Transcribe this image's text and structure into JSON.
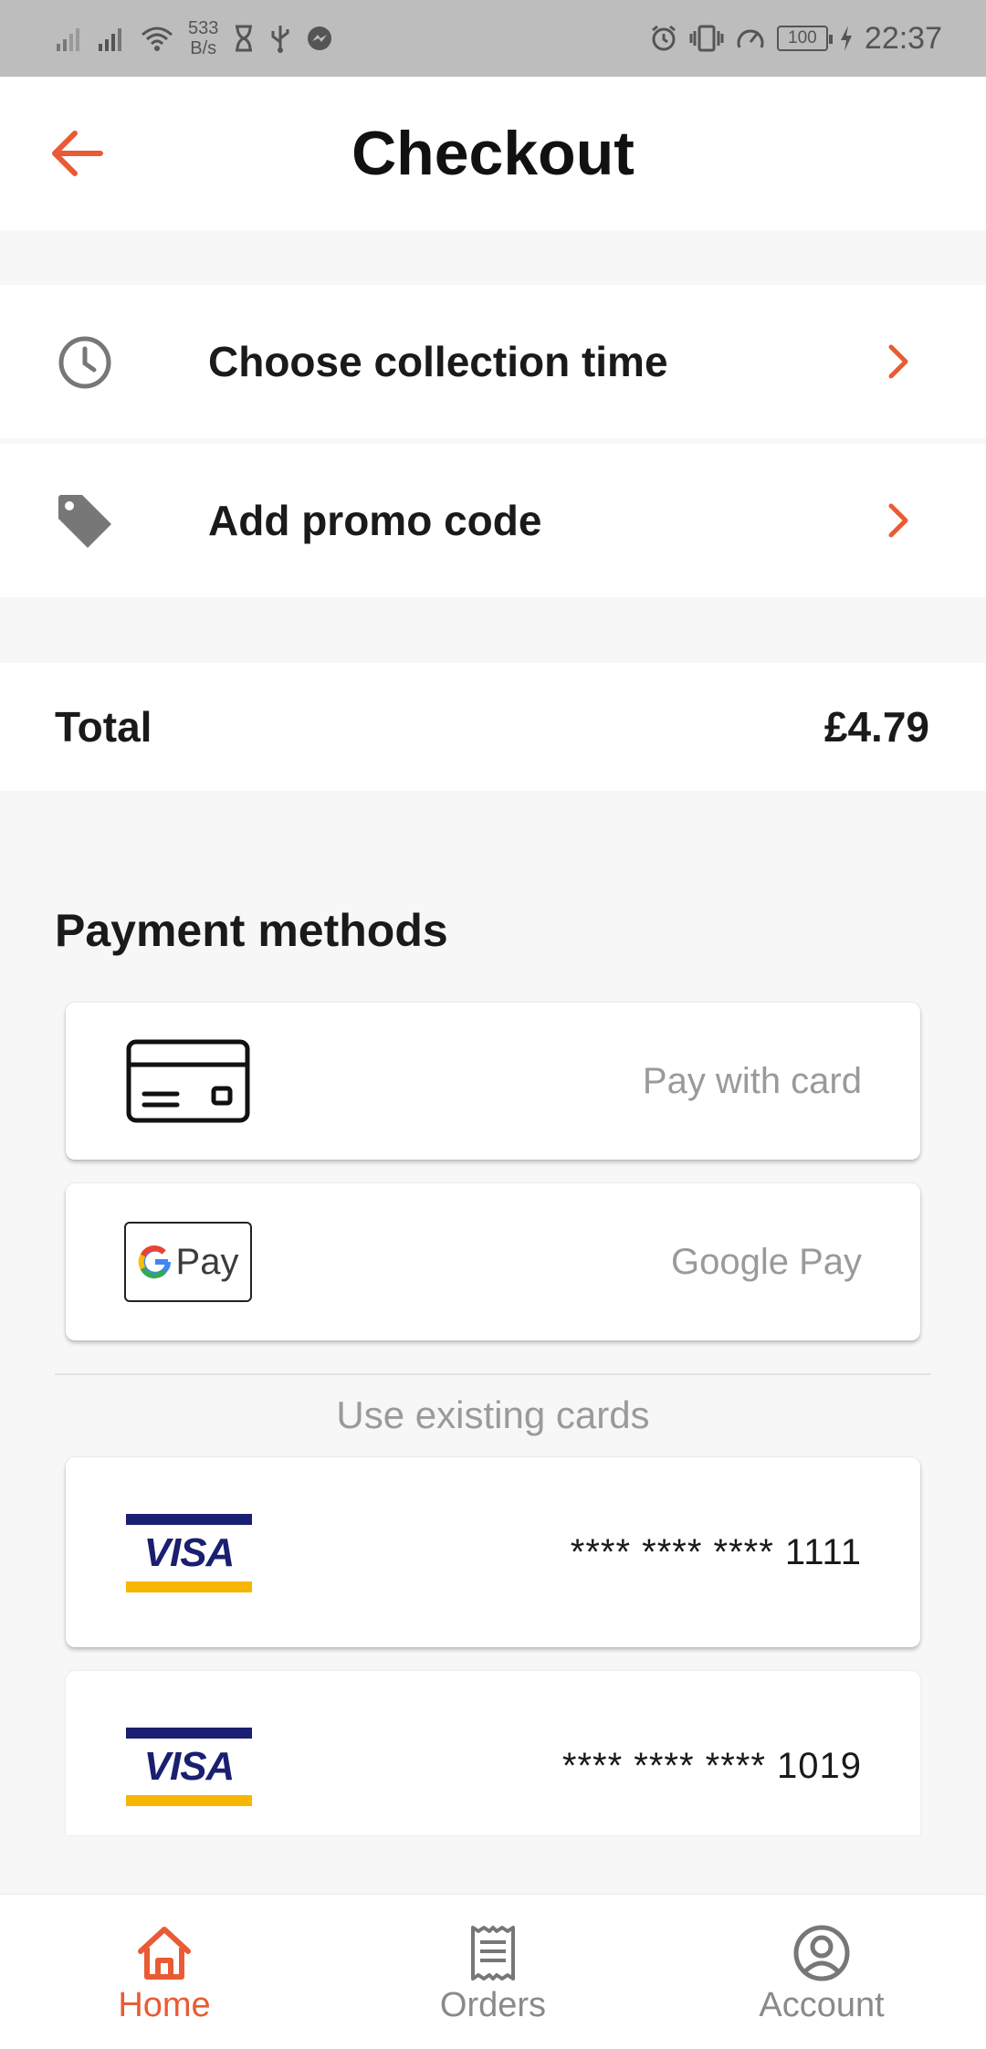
{
  "status_bar": {
    "net_speed_value": "533",
    "net_speed_unit": "B/s",
    "battery": "100",
    "time": "22:37"
  },
  "header": {
    "title": "Checkout",
    "back_icon": "arrow-left-icon"
  },
  "options": [
    {
      "label": "Choose collection time",
      "icon": "clock-icon"
    },
    {
      "label": "Add promo code",
      "icon": "tag-icon"
    }
  ],
  "total": {
    "label": "Total",
    "value": "£4.79"
  },
  "payment": {
    "title": "Payment methods",
    "methods": [
      {
        "label": "Pay with card",
        "icon": "credit-card-icon"
      },
      {
        "label": "Google Pay",
        "logo_text": "Pay"
      }
    ],
    "existing_title": "Use existing cards",
    "saved_cards": [
      {
        "brand": "VISA",
        "number": "**** **** **** 1111"
      },
      {
        "brand": "VISA",
        "number": "**** **** **** 1019"
      }
    ]
  },
  "bottom_nav": [
    {
      "label": "Home",
      "icon": "home-icon",
      "active": true
    },
    {
      "label": "Orders",
      "icon": "receipt-icon",
      "active": false
    },
    {
      "label": "Account",
      "icon": "account-circle-icon",
      "active": false
    }
  ],
  "colors": {
    "accent": "#e95b34",
    "visa_blue": "#1a1f71",
    "visa_gold": "#f7b600",
    "muted_text": "#9a9a9a",
    "status_bar": "#bdbdbd"
  }
}
